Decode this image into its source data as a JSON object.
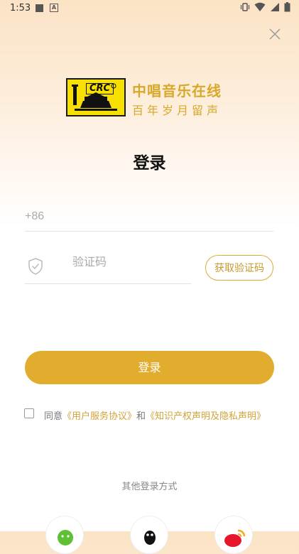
{
  "status_bar": {
    "time": "1:53"
  },
  "brand": {
    "name": "中唱音乐在线",
    "slogan": "百年岁月留声",
    "logo_text": "CRC"
  },
  "title": "登录",
  "phone": {
    "placeholder": "+86"
  },
  "code": {
    "placeholder": "验证码",
    "button_label": "获取验证码"
  },
  "login_button": "登录",
  "agreement": {
    "prefix": "同意",
    "link1": "《用户服务协议》",
    "conj": "和",
    "link2": "《知识产权声明及隐私声明》"
  },
  "other_login": {
    "label": "其他登录方式"
  },
  "colors": {
    "accent": "#e2ad2e",
    "brand_gold": "#d7a829",
    "logo_yellow": "#f7df00"
  }
}
